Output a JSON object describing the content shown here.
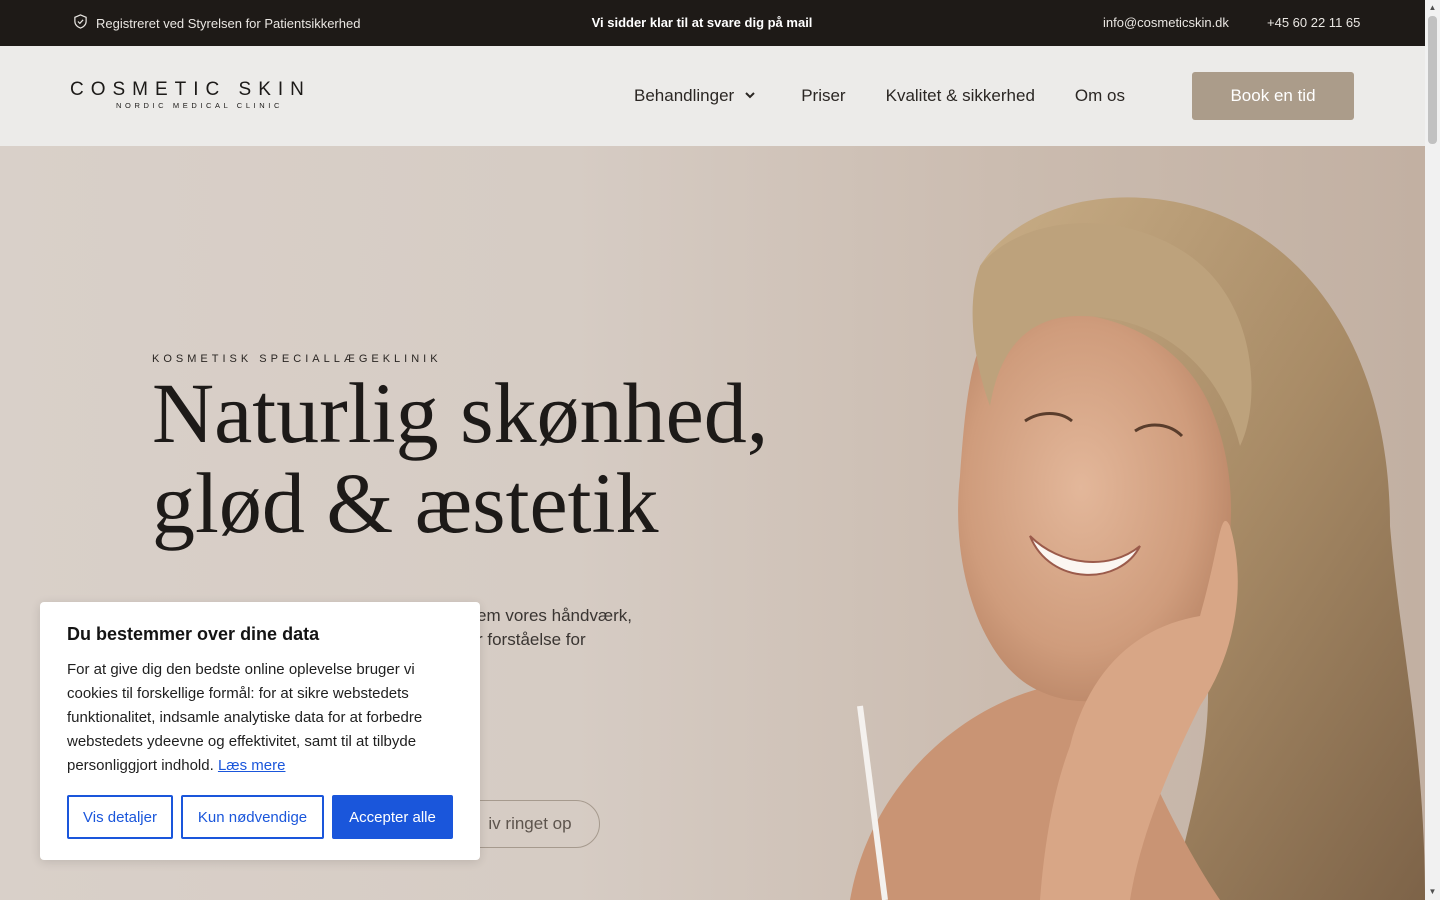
{
  "topbar": {
    "registered": "Registreret ved Styrelsen for Patientsikkerhed",
    "center": "Vi sidder klar til at svare dig på mail",
    "email": "info@cosmeticskin.dk",
    "phone": "+45 60 22 11 65",
    "icon": "shield-check-icon"
  },
  "header": {
    "logo_main": "COSMETIC SKIN",
    "logo_sub": "NORDIC MEDICAL CLINIC",
    "nav": {
      "behandlinger": "Behandlinger",
      "priser": "Priser",
      "kvalitet": "Kvalitet & sikkerhed",
      "omos": "Om os"
    },
    "book": "Book en tid"
  },
  "hero": {
    "eyebrow": "KOSMETISK SPECIALLÆGEKLINIK",
    "headline_line1": "Naturlig skønhed,",
    "headline_line2": "glød & æstetik",
    "text_line1": "em vores håndværk,",
    "text_line2": "r forståelse for",
    "call_button": "iv ringet op"
  },
  "cookie": {
    "title": "Du bestemmer over dine data",
    "body": "For at give dig den bedste online oplevelse bruger vi cookies til forskellige formål: for at sikre webstedets funktionalitet, indsamle analytiske data for at forbedre webstedets ydeevne og effektivitet, samt til at tilbyde personliggjort indhold.",
    "link": "Læs mere",
    "btn_details": "Vis detaljer",
    "btn_necessary": "Kun nødvendige",
    "btn_accept": "Accepter alle"
  },
  "colors": {
    "topbar_bg": "#1e1a17",
    "header_bg": "#ecebe9",
    "accent": "#ab9c8a",
    "cookie_blue": "#1a56db"
  }
}
